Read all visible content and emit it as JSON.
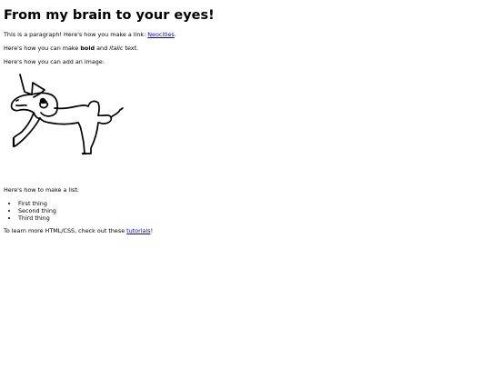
{
  "heading": "From my brain to your eyes!",
  "paragraph_link": {
    "before": "This is a paragraph! Here's how you make a link: ",
    "link_text": "Neocities",
    "after": "."
  },
  "paragraph_format": {
    "before": "Here's how you can make ",
    "bold_text": "bold",
    "middle": " and ",
    "italic_text": "italic",
    "after": " text."
  },
  "paragraph_image": "Here's how you can add an image:",
  "image": {
    "subject": "hand-drawn-creature-icon"
  },
  "paragraph_list": "Here's how to make a list:",
  "list_items": [
    "First thing",
    "Second thing",
    "Third thing"
  ],
  "paragraph_learn": {
    "before": "To learn more HTML/CSS, check out these ",
    "link_text": "tutorials",
    "after": "!"
  },
  "colors": {
    "link": "#0000ee",
    "text": "#000000",
    "background": "#ffffff"
  }
}
